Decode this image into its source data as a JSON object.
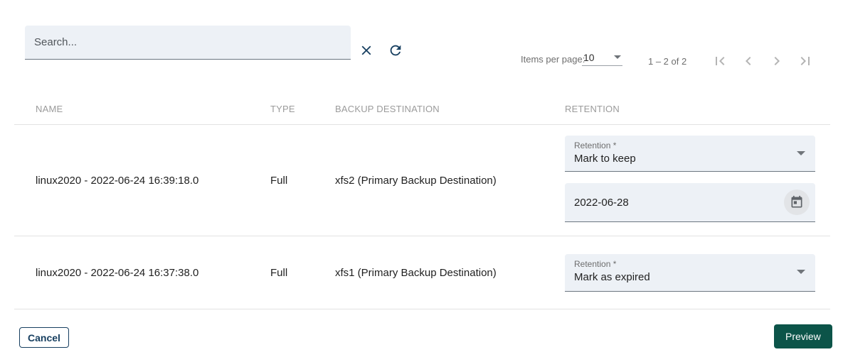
{
  "toolbar": {
    "search_placeholder": "Search..."
  },
  "paginator": {
    "items_per_page_label": "Items per page:",
    "page_size_value": "10",
    "range_label": "1 – 2 of 2"
  },
  "table": {
    "headers": {
      "name": "NAME",
      "type": "TYPE",
      "backup_destination": "BACKUP DESTINATION",
      "retention": "RETENTION"
    },
    "rows": [
      {
        "name": "linux2020 - 2022-06-24 16:39:18.0",
        "type": "Full",
        "backup_destination": "xfs2 (Primary Backup Destination)",
        "retention_label": "Retention *",
        "retention_value": "Mark to keep",
        "keep_until_date": "2022-06-28"
      },
      {
        "name": "linux2020 - 2022-06-24 16:37:38.0",
        "type": "Full",
        "backup_destination": "xfs1 (Primary Backup Destination)",
        "retention_label": "Retention *",
        "retention_value": "Mark as expired"
      }
    ]
  },
  "actions": {
    "cancel_label": "Cancel",
    "preview_label": "Preview"
  },
  "icons": {
    "clear": "close-icon",
    "refresh": "refresh-icon",
    "page_size": "chevron-down-icon",
    "first": "first-page-icon",
    "previous": "chevron-left-icon",
    "next": "chevron-right-icon",
    "last": "last-page-icon",
    "calendar": "calendar-icon"
  },
  "colors": {
    "accent_navy": "#173f60",
    "primary_button_green": "#0c5449",
    "field_fill": "#edf1f6",
    "divider": "#e2e2e2",
    "disabled_icon": "#b4b4b4"
  }
}
